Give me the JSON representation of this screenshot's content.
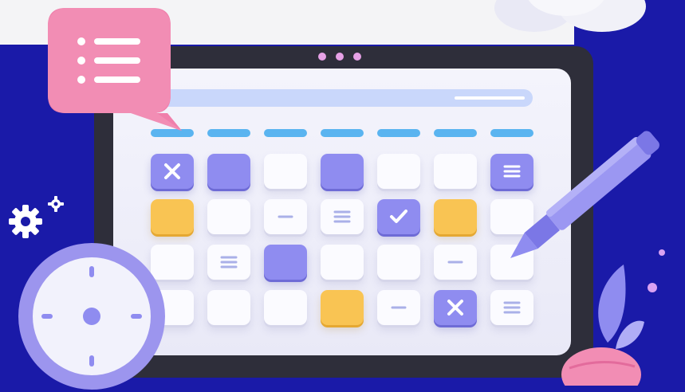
{
  "colors": {
    "background": "#1a1aa8",
    "tablet": "#2e2e3a",
    "screen": "#f4f4fc",
    "accent_purple": "#8f8cf0",
    "accent_yellow": "#f9c453",
    "accent_blue": "#5ab4f0",
    "bubble_pink": "#f07fab"
  },
  "calendar": {
    "columns": 7,
    "rows": [
      [
        {
          "color": "purple",
          "icon": "x-icon"
        },
        {
          "color": "purple",
          "icon": ""
        },
        {
          "color": "white",
          "icon": ""
        },
        {
          "color": "purple",
          "icon": ""
        },
        {
          "color": "white",
          "icon": ""
        },
        {
          "color": "white",
          "icon": ""
        },
        {
          "color": "purple",
          "icon": "lines-icon"
        }
      ],
      [
        {
          "color": "yellow",
          "icon": ""
        },
        {
          "color": "white",
          "icon": ""
        },
        {
          "color": "white",
          "icon": "dash-icon"
        },
        {
          "color": "white",
          "icon": "lines-icon"
        },
        {
          "color": "purple",
          "icon": "check-icon"
        },
        {
          "color": "yellow",
          "icon": ""
        },
        {
          "color": "white",
          "icon": ""
        }
      ],
      [
        {
          "color": "white",
          "icon": ""
        },
        {
          "color": "white",
          "icon": "lines-icon"
        },
        {
          "color": "purple",
          "icon": ""
        },
        {
          "color": "white",
          "icon": ""
        },
        {
          "color": "white",
          "icon": ""
        },
        {
          "color": "white",
          "icon": "dash-icon"
        },
        {
          "color": "white",
          "icon": ""
        }
      ],
      [
        {
          "color": "white",
          "icon": ""
        },
        {
          "color": "white",
          "icon": ""
        },
        {
          "color": "white",
          "icon": ""
        },
        {
          "color": "yellow",
          "icon": ""
        },
        {
          "color": "white",
          "icon": "dash-icon"
        },
        {
          "color": "purple",
          "icon": "x-icon"
        },
        {
          "color": "white",
          "icon": "lines-icon"
        }
      ]
    ]
  },
  "decorations": {
    "bubble_icon": "list-icon",
    "clock_icon": "clock-icon",
    "gear_icon": "gear-icon",
    "pen_icon": "pen-icon",
    "plant_icon": "plant-icon",
    "cloud_icon": "cloud-icon"
  }
}
